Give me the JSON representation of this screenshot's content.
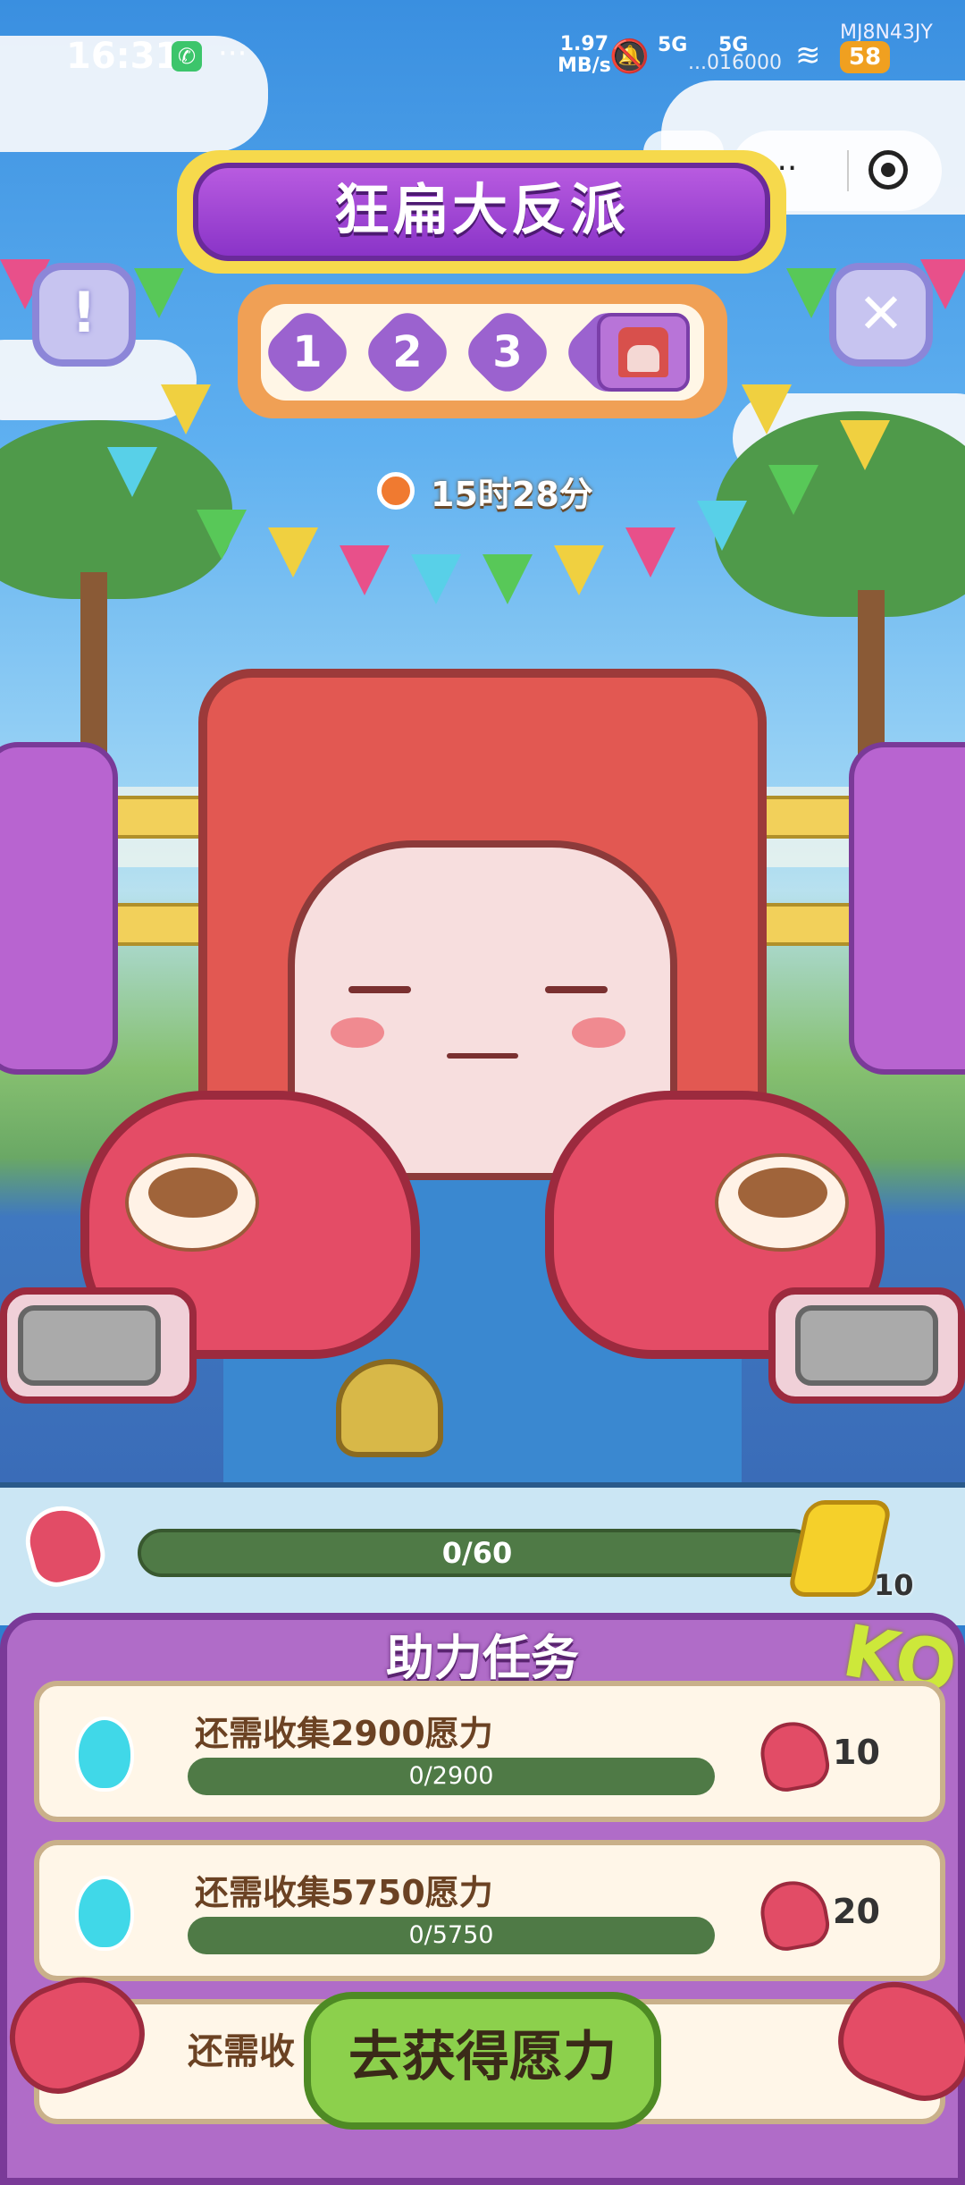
{
  "status_bar": {
    "time": "16:31",
    "dots": "···",
    "net_speed_value": "1.97",
    "net_speed_unit": "MB/s",
    "signal_1": "5G",
    "signal_2": "5G",
    "battery": "58",
    "device_id": "MJ8N43JY",
    "user_id": "...016000"
  },
  "capsule": {
    "more_label": "···"
  },
  "title": "狂扁大反派",
  "stages": {
    "items": [
      "1",
      "2",
      "3"
    ]
  },
  "timer": "15时28分",
  "progress": {
    "text": "0/60",
    "current": 0,
    "max": 60,
    "bolt_count": "10"
  },
  "tasks": {
    "title": "助力任务",
    "ko": "KO",
    "items": [
      {
        "label": "还需收集2900愿力",
        "progress_text": "0/2900",
        "current": 0,
        "max": 2900,
        "reward": "10"
      },
      {
        "label": "还需收集5750愿力",
        "progress_text": "0/5750",
        "current": 0,
        "max": 5750,
        "reward": "20"
      }
    ],
    "peek_label": "还需收"
  },
  "cta": {
    "label": "去获得愿力"
  },
  "icons": {
    "info": "!",
    "close": "✕",
    "phone": "✆",
    "bell_off": "🔕",
    "wifi": "≋"
  },
  "colors": {
    "title_purple": "#8a34c8",
    "panel_purple": "#b06cc8",
    "cta_green": "#8cd04c",
    "bar_green": "#4f7a46"
  }
}
